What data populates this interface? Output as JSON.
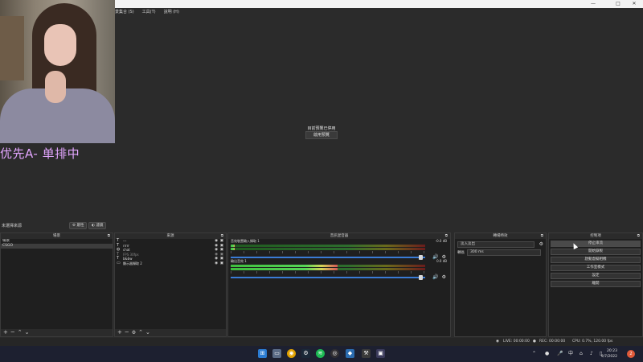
{
  "window": {
    "minimize": "—",
    "maximize": "□",
    "close": "✕"
  },
  "menu": [
    "景集合 (S)",
    "工具(T)",
    "說明 (H)"
  ],
  "preview": {
    "message": "目前預覽已停用",
    "enable_button": "啟用預覽"
  },
  "overlay_text": "优先A- 单排中",
  "toolbar": {
    "no_scene_label": "未選擇來源",
    "properties_label": "屬性",
    "filters_label": "濾鏡"
  },
  "scenes": {
    "title": "場景",
    "items": [
      "場景",
      "CSGO"
    ],
    "active_index": 1
  },
  "sources": {
    "title": "來源",
    "items": [
      {
        "label": "---",
        "icon": "text-icon",
        "dim": false
      },
      {
        "label": "rrrrr",
        "icon": "text-icon",
        "dim": false
      },
      {
        "label": "chat",
        "icon": "browser-icon",
        "dim": false
      },
      {
        "label": "FPS  30fps",
        "icon": "text-icon",
        "dim": true
      },
      {
        "label": "b&bw",
        "icon": "text-icon",
        "dim": false
      },
      {
        "label": "顯示器擷取 2",
        "icon": "monitor-icon",
        "dim": false
      }
    ]
  },
  "mixer": {
    "title": "音訊混音器",
    "channels": [
      {
        "name": "音效裝置輸入擷取 1",
        "db": "-0.0 dB",
        "level": 0.02,
        "volume": 0.98
      },
      {
        "name": "輸出音效 1",
        "db": "0.0 dB",
        "level": 0.55,
        "volume": 0.98
      }
    ]
  },
  "transitions": {
    "title": "轉場特效",
    "selected": "淡入淡出",
    "duration_label": "轉長",
    "duration_value": "300 ms"
  },
  "controls": {
    "title": "控制項",
    "buttons": [
      "停止串流",
      "開始錄製",
      "啟動虛擬相機",
      "工作室模式",
      "設定",
      "離開"
    ]
  },
  "status": {
    "live": "LIVE: 00:00:00",
    "rec": "REC: 00:00:00",
    "cpu": "CPU: 0.7%, 120.00 fps"
  },
  "taskbar": {
    "ime": "中",
    "time": "20:23",
    "date": "9/7/2022",
    "notifications": "2"
  },
  "colors": {
    "overlay_text": "#e3a6ff",
    "slider": "#3a7bd5",
    "meter_green": "#3fbf3f"
  }
}
